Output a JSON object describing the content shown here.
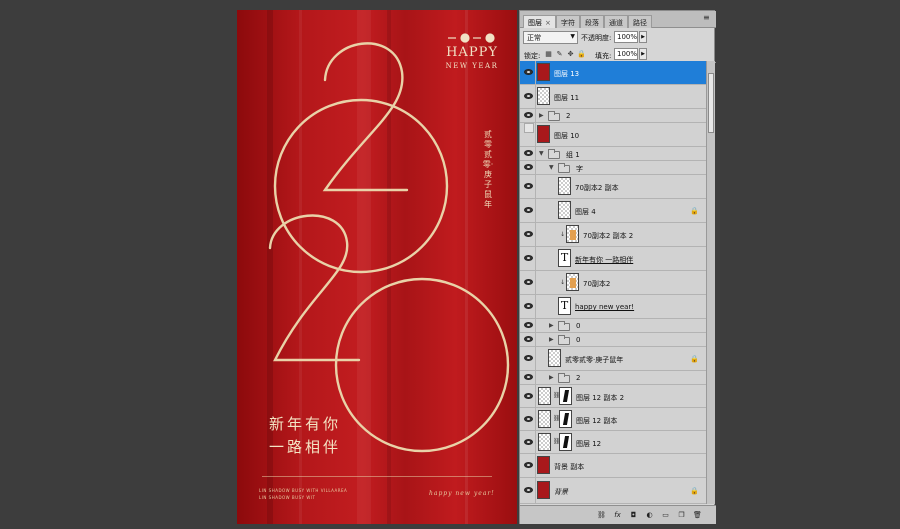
{
  "poster": {
    "year_top": "二〇二〇",
    "happy": "HAPPY",
    "new_year": "NEW YEAR",
    "vertical_text": "贰零贰零·庚子鼠年",
    "cn_line1": "新年有你",
    "cn_line2": "一路相伴",
    "small_line1": "LIN SHADOW BUSY WITH VILLAAREA",
    "small_line2": "LIN SHADOW BUSY WIT",
    "script_text": "happy new year!",
    "colors": {
      "red": "#b3171a",
      "gold": "#e9d2a8"
    }
  },
  "panel": {
    "tabs": [
      {
        "label": "图层",
        "active": true,
        "closable": true
      },
      {
        "label": "字符",
        "active": false
      },
      {
        "label": "段落",
        "active": false
      },
      {
        "label": "通道",
        "active": false
      },
      {
        "label": "路径",
        "active": false
      }
    ],
    "blend_mode": "正常",
    "opacity_label": "不透明度:",
    "opacity_value": "100%",
    "lock_label": "锁定:",
    "fill_label": "填充:",
    "fill_value": "100%",
    "layers": [
      {
        "name": "图层 13",
        "kind": "image-red",
        "visible": true,
        "selected": true
      },
      {
        "name": "图层 11",
        "kind": "image-trans",
        "visible": true
      },
      {
        "name": "2",
        "kind": "group-closed",
        "visible": true
      },
      {
        "name": "图层 10",
        "kind": "image-red",
        "visible": false
      },
      {
        "name": "组 1",
        "kind": "group-open",
        "visible": true
      },
      {
        "name": "字",
        "kind": "group-open",
        "visible": true
      },
      {
        "name": "70副本2 副本",
        "kind": "image-trans",
        "visible": true
      },
      {
        "name": "图层 4",
        "kind": "image-trans",
        "visible": true,
        "locked": true
      },
      {
        "name": "70副本2 副本 2",
        "kind": "image-gold",
        "visible": true,
        "clipped": true
      },
      {
        "name": "新年有你 一路相伴",
        "kind": "text",
        "visible": true
      },
      {
        "name": "70副本2",
        "kind": "image-gold",
        "visible": true,
        "clipped": true
      },
      {
        "name": "happy new year!",
        "kind": "text",
        "visible": true
      },
      {
        "name": "0",
        "kind": "group-closed",
        "visible": true
      },
      {
        "name": "0",
        "kind": "group-closed",
        "visible": true
      },
      {
        "name": "贰零贰零·庚子鼠年",
        "kind": "image-trans",
        "visible": true,
        "locked": true
      },
      {
        "name": "2",
        "kind": "group-closed",
        "visible": true
      },
      {
        "name": "图层 12 副本 2",
        "kind": "masked",
        "visible": true
      },
      {
        "name": "图层 12 副本",
        "kind": "masked",
        "visible": true
      },
      {
        "name": "图层 12",
        "kind": "masked",
        "visible": true
      },
      {
        "name": "背景 副本",
        "kind": "image-red",
        "visible": true
      },
      {
        "name": "背景",
        "kind": "image-red",
        "visible": true,
        "locked": true,
        "italic": true
      }
    ],
    "footer_icons": [
      "link-icon",
      "fx-icon",
      "mask-icon",
      "adjustment-icon",
      "new-group-icon",
      "new-layer-icon",
      "trash-icon"
    ]
  }
}
